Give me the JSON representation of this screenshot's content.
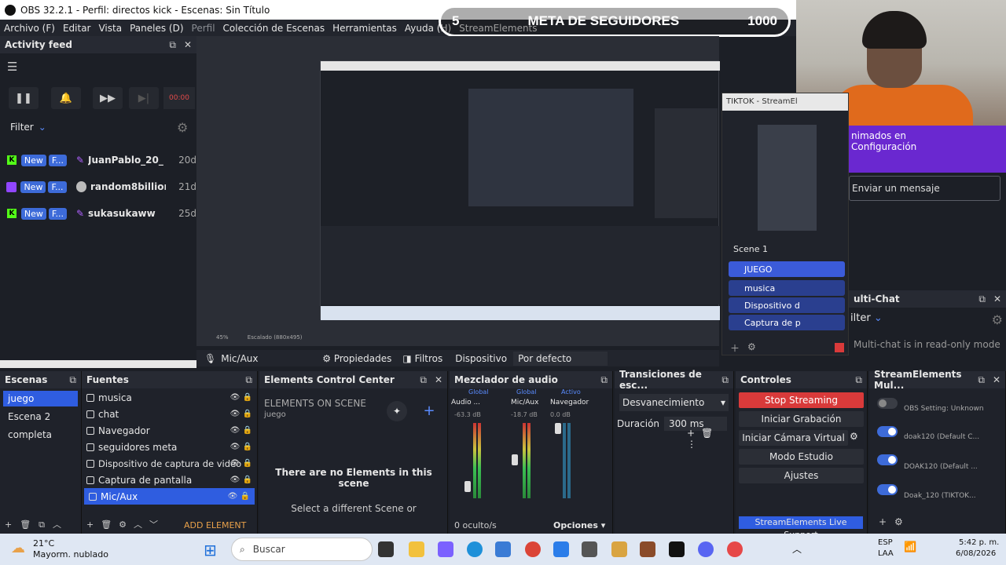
{
  "window": {
    "title": "OBS 32.2.1 - Perfil: directos kick - Escenas: Sin Título"
  },
  "menu": [
    "Archivo (F)",
    "Editar",
    "Vista",
    "Paneles (D)",
    "Perfil",
    "Colección de Escenas",
    "Herramientas",
    "Ayuda (H)",
    "StreamElements"
  ],
  "overlay": {
    "goal_left": "5",
    "goal_title": "META DE SEGUIDORES",
    "goal_right": "1000"
  },
  "activity_feed": {
    "title": "Activity feed",
    "timer": "00:00",
    "filter_label": "Filter",
    "items": [
      {
        "platform": "kick",
        "badge": "New",
        "tag": "F...",
        "user": "JuanPablo_20_",
        "age": "20d"
      },
      {
        "platform": "twitch",
        "badge": "New",
        "tag": "F...",
        "user": "random8billior",
        "age": "21d"
      },
      {
        "platform": "kick",
        "badge": "New",
        "tag": "F...",
        "user": "sukasukaww",
        "age": "25d"
      }
    ]
  },
  "preview": {
    "zoom": "45%",
    "scale": "Escalado (880x495)"
  },
  "tiktok_card": {
    "title": "TIKTOK - StreamEl",
    "scene_name": "Scene 1",
    "items": [
      "JUEGO",
      "musica",
      "Dispositivo d",
      "Captura de p"
    ]
  },
  "chat": {
    "banner_line1": "nimados en",
    "banner_line2": "Configuración",
    "message_placeholder": "Enviar un mensaje",
    "multichat_title": "ulti-Chat",
    "filter_label": "ilter",
    "readonly_note": "Multi-chat is in read-only mode"
  },
  "props_bar": {
    "source": "Mic/Aux",
    "properties": "Propiedades",
    "filters": "Filtros",
    "device_label": "Dispositivo",
    "device_value": "Por defecto"
  },
  "scenes": {
    "title": "Escenas",
    "items": [
      "juego",
      "Escena 2",
      "completa"
    ],
    "selected": "juego"
  },
  "sources": {
    "title": "Fuentes",
    "items": [
      "musica",
      "chat",
      "Navegador",
      "seguidores meta",
      "Dispositivo de captura de video",
      "Captura de pantalla",
      "Mic/Aux"
    ],
    "selected": "Mic/Aux",
    "add_element": "ADD ELEMENT"
  },
  "elements": {
    "title": "Elements Control Center",
    "heading": "ELEMENTS ON SCENE",
    "scene": "juego",
    "empty_title": "There are no Elements in this scene",
    "empty_sub": "Select a different Scene or"
  },
  "mixer": {
    "title": "Mezclador de audio",
    "tabs": [
      "Global",
      "Global",
      "Activo"
    ],
    "channels": [
      {
        "name": "Audio ...",
        "db": "-63.3 dB"
      },
      {
        "name": "Mic/Aux",
        "db": "-18.7 dB"
      },
      {
        "name": "Navegador",
        "db": "0.0 dB"
      }
    ],
    "scale": [
      "6",
      "0",
      "-6",
      "-12",
      "-18",
      "-24",
      "-30",
      "-36",
      "-42",
      "-48",
      "-54",
      "-60"
    ],
    "hidden": "0 oculto/s",
    "options": "Opciones"
  },
  "transitions": {
    "title": "Transiciones de esc...",
    "type": "Desvanecimiento",
    "duration_label": "Duración",
    "duration_value": "300 ms"
  },
  "controls": {
    "title": "Controles",
    "buttons": [
      "Stop Streaming",
      "Iniciar Grabación",
      "Iniciar Cámara Virtual",
      "Modo Estudio",
      "Ajustes"
    ],
    "support": "StreamElements Live Support"
  },
  "multistream": {
    "title": "StreamElements Mul...",
    "items": [
      {
        "label": "OBS Setting: Unknown",
        "on": false
      },
      {
        "label": "doak120 (Default C...",
        "on": true
      },
      {
        "label": "DOAK120 (Default ...",
        "on": true
      },
      {
        "label": "Doak_120 (TIKTOK...",
        "on": true
      }
    ]
  },
  "taskbar": {
    "weather_temp": "21°C",
    "weather_desc": "Mayorm. nublado",
    "search": "Buscar",
    "lang1": "ESP",
    "lang2": "LAA",
    "time": "5:42 p. m.",
    "date": "6/08/2026"
  },
  "colors": {
    "accent": "#2f5de0",
    "stop": "#d93a3a",
    "kick": "#53fc18",
    "twitch": "#9146ff"
  }
}
